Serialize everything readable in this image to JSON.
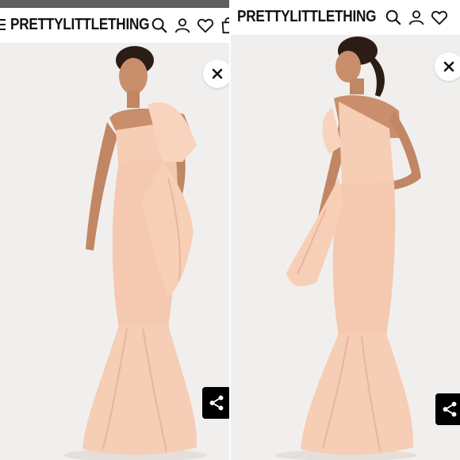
{
  "left_screen": {
    "brand": "PRETTYLITTLETHING",
    "header_icons": [
      "search-icon",
      "account-icon",
      "heart-icon",
      "bag-icon"
    ],
    "close_icon": "close-icon",
    "share_icon": "share-icon"
  },
  "right_screen": {
    "brand": "PRETTYLITTLETHING",
    "header_icons": [
      "search-icon",
      "account-icon",
      "heart-icon"
    ],
    "close_icon": "close-icon",
    "share_icon": "share-icon"
  },
  "colors": {
    "dress": "#f6cdb5",
    "dress_shadow": "#e9b59b",
    "skin": "#c98e6b",
    "hair": "#2b1d16",
    "background": "#f1efed"
  }
}
